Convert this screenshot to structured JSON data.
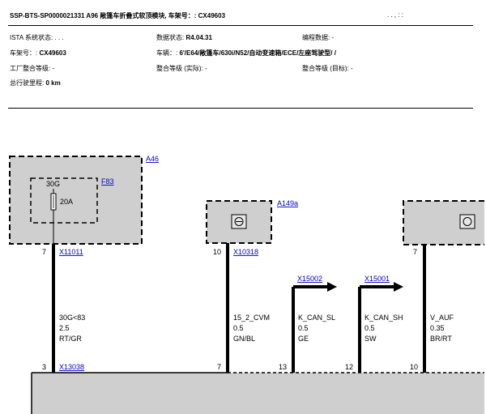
{
  "header": {
    "title": "SSP-BTS-SP0000021331 A96 敞篷车折叠式软顶模块, 车架号：: CX49603",
    "title_right": ". .   , : :",
    "ista_label": "ISTA 系统状态: . . .",
    "data_status_label": "数据状态: ",
    "data_status_value": "R4.04.31",
    "prog_data": "编程数据: -",
    "vin_label": "车架号：: ",
    "vin_value": "CX49603",
    "vehicle_label": "车辆：: ",
    "vehicle_value": "6'/E64/敞篷车/630i/N52/自动变速箱/ECE/左座驾驶型/    /",
    "factory_level": "工厂整合等级: -",
    "actual_level": "整合等级 (实际): -",
    "target_level": "整合等级 (目标): -",
    "mileage_label": "总行驶里程: ",
    "mileage_value": "0 km"
  },
  "diagram": {
    "components": {
      "a46": "A46",
      "f83": "F83",
      "fuse_pin": "30G",
      "fuse_rating": "20A",
      "a149a": "A149a"
    },
    "top_connectors": [
      {
        "pin": "7",
        "ref": "X11011"
      },
      {
        "pin": "10",
        "ref": "X10318"
      },
      {
        "pin": "7",
        "ref": ""
      }
    ],
    "arrow_connectors": [
      "X15002",
      "X15001"
    ],
    "wires": [
      {
        "signal": "30G<83",
        "size": "2.5",
        "color": "RT/GR"
      },
      {
        "signal": "15_2_CVM",
        "size": "0.5",
        "color": "GN/BL"
      },
      {
        "signal": "K_CAN_SL",
        "size": "0.5",
        "color": "GE"
      },
      {
        "signal": "K_CAN_SH",
        "size": "0.5",
        "color": "SW"
      },
      {
        "signal": "V_AUF",
        "size": "0.35",
        "color": "BR/RT"
      }
    ],
    "bottom_pins": [
      "3",
      "7",
      "13",
      "12",
      "10"
    ],
    "bottom_connector": "X13038"
  }
}
